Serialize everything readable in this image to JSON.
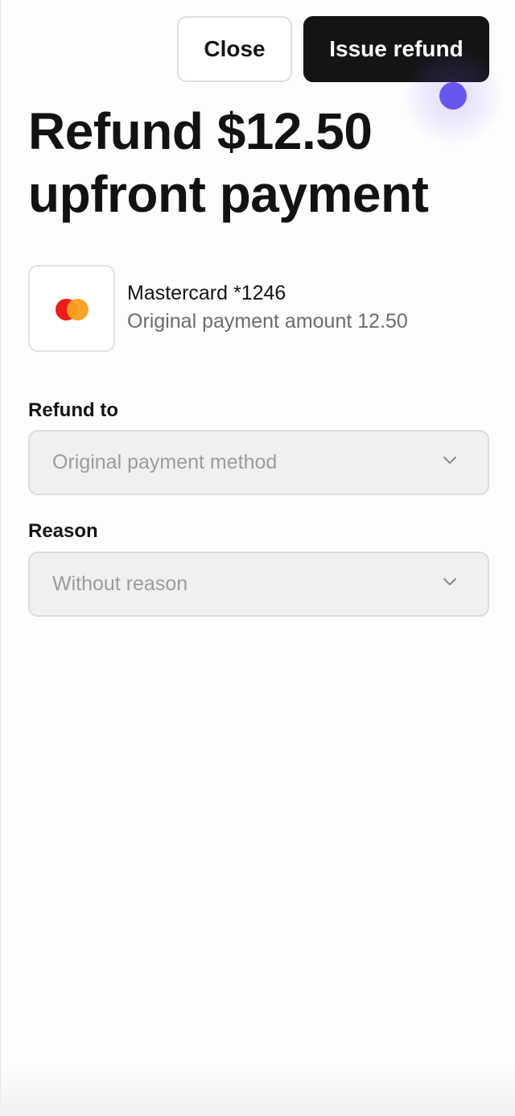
{
  "header": {
    "close_label": "Close",
    "issue_refund_label": "Issue refund"
  },
  "title": "Refund $12.50 upfront payment",
  "payment": {
    "card_label": "Mastercard *1246",
    "original_amount_text": "Original payment amount 12.50",
    "brand_icon": "mastercard-icon",
    "brand_colors": [
      "#eb1c1c",
      "#f8a01b"
    ]
  },
  "form": {
    "refund_to": {
      "label": "Refund to",
      "value": "Original payment method"
    },
    "reason": {
      "label": "Reason",
      "value": "Without reason"
    }
  },
  "colors": {
    "primary_button": "#141414",
    "touch_indicator": "#6656ee",
    "field_background": "#f0f0f0"
  }
}
